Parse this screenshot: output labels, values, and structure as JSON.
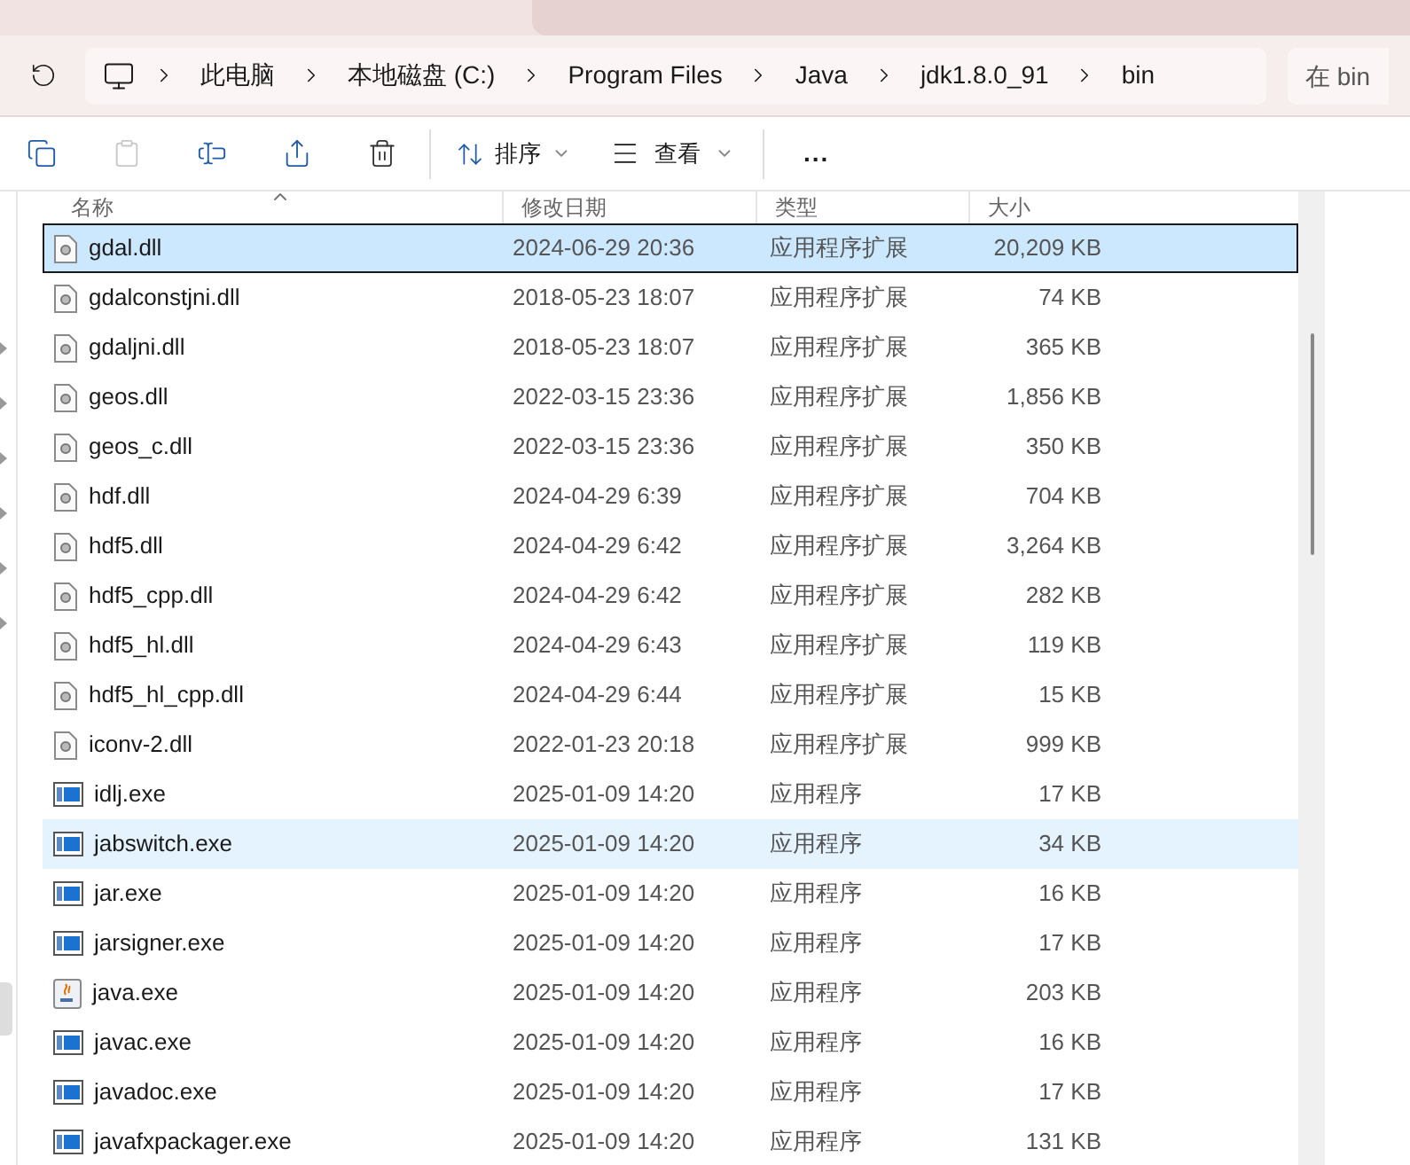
{
  "address_bar": {
    "crumbs": [
      "此电脑",
      "本地磁盘 (C:)",
      "Program Files",
      "Java",
      "jdk1.8.0_91",
      "bin"
    ],
    "search": {
      "placeholder": "在 bin"
    }
  },
  "toolbar": {
    "buttons": [
      {
        "kind": "copy",
        "disabled": false
      },
      {
        "kind": "paste",
        "disabled": true
      },
      {
        "kind": "rename",
        "disabled": false
      },
      {
        "kind": "share",
        "disabled": false
      },
      {
        "kind": "delete",
        "disabled": false
      }
    ],
    "sort": "排序",
    "view": "查看",
    "more": "..."
  },
  "table": {
    "columns": [
      "名称",
      "修改日期",
      "类型",
      "大小"
    ],
    "rows": [
      {
        "kind": "dll",
        "name": "gdal.dll",
        "date": "2024-06-29 20:36",
        "type": "应用程序扩展",
        "size": "20,209 KB",
        "selected": true,
        "hovered": false
      },
      {
        "kind": "dll",
        "name": "gdalconstjni.dll",
        "date": "2018-05-23 18:07",
        "type": "应用程序扩展",
        "size": "74 KB",
        "selected": false,
        "hovered": false
      },
      {
        "kind": "dll",
        "name": "gdaljni.dll",
        "date": "2018-05-23 18:07",
        "type": "应用程序扩展",
        "size": "365 KB",
        "selected": false,
        "hovered": false
      },
      {
        "kind": "dll",
        "name": "geos.dll",
        "date": "2022-03-15 23:36",
        "type": "应用程序扩展",
        "size": "1,856 KB",
        "selected": false,
        "hovered": false
      },
      {
        "kind": "dll",
        "name": "geos_c.dll",
        "date": "2022-03-15 23:36",
        "type": "应用程序扩展",
        "size": "350 KB",
        "selected": false,
        "hovered": false
      },
      {
        "kind": "dll",
        "name": "hdf.dll",
        "date": "2024-04-29 6:39",
        "type": "应用程序扩展",
        "size": "704 KB",
        "selected": false,
        "hovered": false
      },
      {
        "kind": "dll",
        "name": "hdf5.dll",
        "date": "2024-04-29 6:42",
        "type": "应用程序扩展",
        "size": "3,264 KB",
        "selected": false,
        "hovered": false
      },
      {
        "kind": "dll",
        "name": "hdf5_cpp.dll",
        "date": "2024-04-29 6:42",
        "type": "应用程序扩展",
        "size": "282 KB",
        "selected": false,
        "hovered": false
      },
      {
        "kind": "dll",
        "name": "hdf5_hl.dll",
        "date": "2024-04-29 6:43",
        "type": "应用程序扩展",
        "size": "119 KB",
        "selected": false,
        "hovered": false
      },
      {
        "kind": "dll",
        "name": "hdf5_hl_cpp.dll",
        "date": "2024-04-29 6:44",
        "type": "应用程序扩展",
        "size": "15 KB",
        "selected": false,
        "hovered": false
      },
      {
        "kind": "dll",
        "name": "iconv-2.dll",
        "date": "2022-01-23 20:18",
        "type": "应用程序扩展",
        "size": "999 KB",
        "selected": false,
        "hovered": false
      },
      {
        "kind": "exe",
        "name": "idlj.exe",
        "date": "2025-01-09 14:20",
        "type": "应用程序",
        "size": "17 KB",
        "selected": false,
        "hovered": false
      },
      {
        "kind": "exe",
        "name": "jabswitch.exe",
        "date": "2025-01-09 14:20",
        "type": "应用程序",
        "size": "34 KB",
        "selected": false,
        "hovered": true
      },
      {
        "kind": "exe",
        "name": "jar.exe",
        "date": "2025-01-09 14:20",
        "type": "应用程序",
        "size": "16 KB",
        "selected": false,
        "hovered": false
      },
      {
        "kind": "exe",
        "name": "jarsigner.exe",
        "date": "2025-01-09 14:20",
        "type": "应用程序",
        "size": "17 KB",
        "selected": false,
        "hovered": false
      },
      {
        "kind": "java",
        "name": "java.exe",
        "date": "2025-01-09 14:20",
        "type": "应用程序",
        "size": "203 KB",
        "selected": false,
        "hovered": false
      },
      {
        "kind": "exe",
        "name": "javac.exe",
        "date": "2025-01-09 14:20",
        "type": "应用程序",
        "size": "16 KB",
        "selected": false,
        "hovered": false
      },
      {
        "kind": "exe",
        "name": "javadoc.exe",
        "date": "2025-01-09 14:20",
        "type": "应用程序",
        "size": "17 KB",
        "selected": false,
        "hovered": false
      },
      {
        "kind": "exe",
        "name": "javafxpackager.exe",
        "date": "2025-01-09 14:20",
        "type": "应用程序",
        "size": "131 KB",
        "selected": false,
        "hovered": false
      }
    ]
  }
}
